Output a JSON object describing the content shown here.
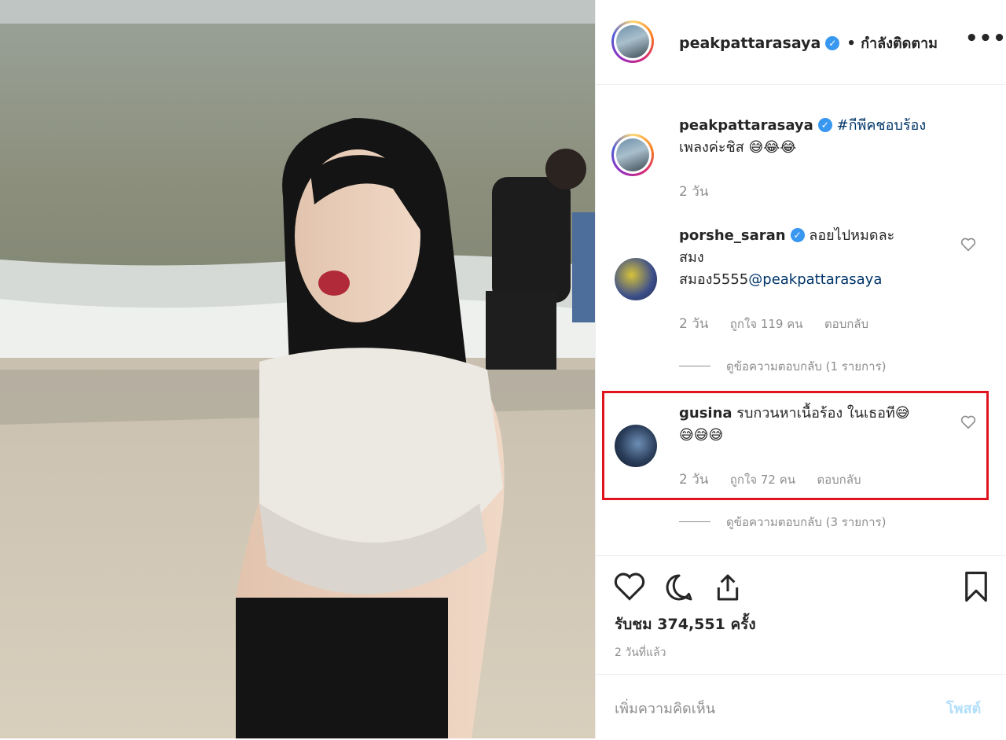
{
  "post": {
    "author": "peakpattarasaya",
    "follow_status": "• กำลังติดตาม",
    "more_icon": "more-horizontal-icon"
  },
  "caption": {
    "username": "peakpattarasaya",
    "hashtag": "#กีพีคชอบร้อง",
    "text": "เพลงค่ะชิส 😅😂😂",
    "age": "2 วัน"
  },
  "comments": [
    {
      "username": "porshe_saran",
      "text_line1": "ลอยไปหมดละ",
      "text_line2": "สมง",
      "text_line3": "สมอง5555",
      "mention": "@peakpattarasaya",
      "age": "2 วัน",
      "likes": "ถูกใจ 119 คน",
      "reply": "ตอบกลับ",
      "view_replies": "ดูข้อความตอบกลับ (1 รายการ)"
    },
    {
      "username": "gusina",
      "text_line1": "รบกวนหาเนื้อร้อง ในเธอที😅",
      "text_line2": "😅😅😅",
      "age": "2 วัน",
      "likes": "ถูกใจ 72 คน",
      "reply": "ตอบกลับ",
      "view_replies": "ดูข้อความตอบกลับ (3 รายการ)"
    }
  ],
  "actions": {
    "views": "รับชม 374,551 ครั้ง",
    "posted": "2 วันที่แล้ว",
    "comment_placeholder": "เพิ่มความคิดเห็น",
    "post_button": "โพสต์"
  },
  "colors": {
    "highlight": "#e0141e",
    "link": "#003569",
    "muted": "#8e8e8e",
    "verified": "#3897f0"
  }
}
